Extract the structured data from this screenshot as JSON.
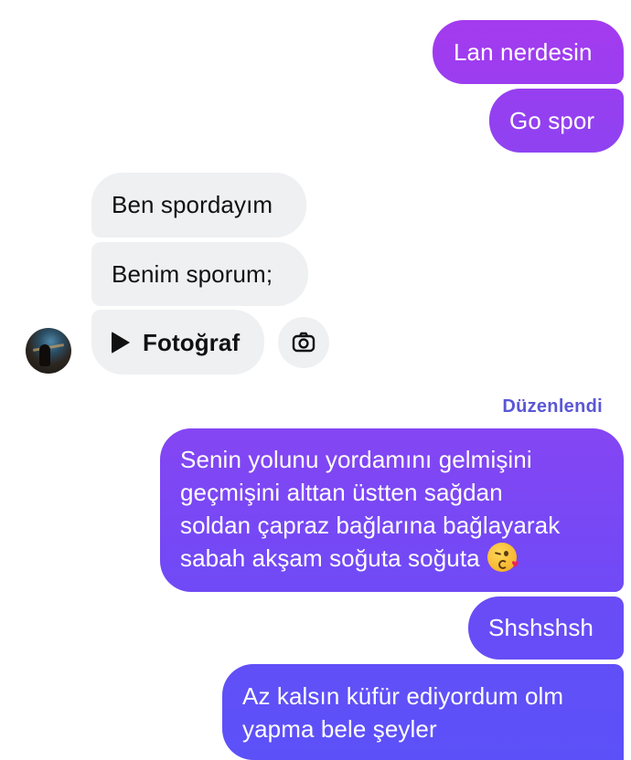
{
  "outgoing_top": [
    {
      "text": "Lan nerdesin"
    },
    {
      "text": "Go spor"
    }
  ],
  "incoming": [
    {
      "text": "Ben spordayım"
    },
    {
      "text": "Benim sporum;"
    },
    {
      "label": "Fotoğraf",
      "icon": "play-icon"
    }
  ],
  "camera_button": {
    "icon": "camera-icon"
  },
  "avatar": {
    "icon": "avatar-photo"
  },
  "edited_label": "Düzenlendi",
  "outgoing_bottom": [
    {
      "lines": [
        "Senin yolunu yordamını gelmişini",
        "geçmişini alttan üstten sağdan",
        "soldan çapraz bağlarına bağlayarak",
        "sabah akşam soğuta soğuta"
      ],
      "emoji": "kissing-heart-emoji"
    },
    {
      "text": "Shshshsh"
    },
    {
      "lines": [
        "Az kalsın küfür ediyordum olm",
        "yapma bele şeyler"
      ]
    }
  ],
  "colors": {
    "outgoing_top": "#a43bee",
    "outgoing_bottom": "#5c51f8",
    "incoming_bg": "#eff0f2",
    "edited_text": "#5a57d6"
  }
}
